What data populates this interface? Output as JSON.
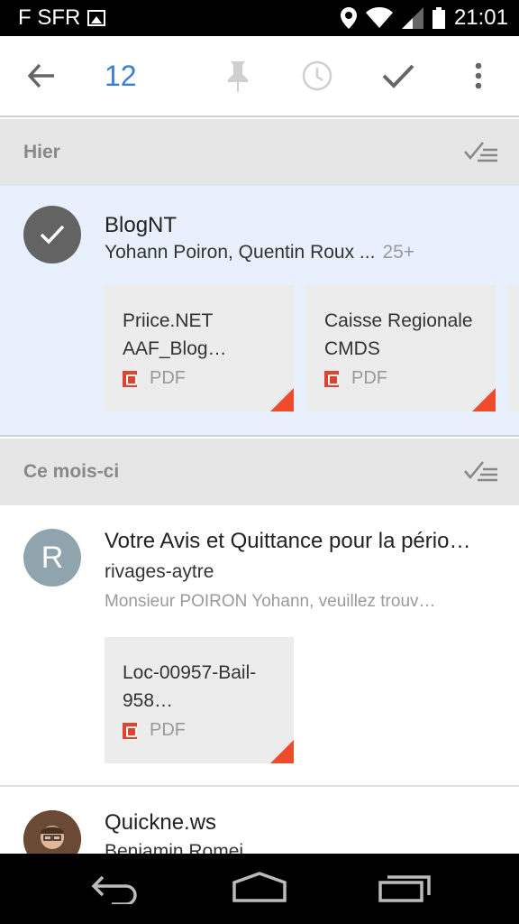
{
  "status": {
    "carrier": "F SFR",
    "time": "21:01"
  },
  "toolbar": {
    "back_icon": "arrow-back-icon",
    "selected_count": "12",
    "pin_icon": "pin-icon",
    "snooze_icon": "clock-icon",
    "done_icon": "check-icon",
    "overflow_icon": "more-vert-icon"
  },
  "sections": [
    {
      "label": "Hier"
    },
    {
      "label": "Ce mois-ci"
    }
  ],
  "threads": [
    {
      "title": "BlogNT",
      "senders": "Yohann Poiron, Quentin Roux ...",
      "count": "25+",
      "selected": true,
      "attachments": [
        {
          "name": "Priice.NET AAF_Blog…",
          "type": "PDF"
        },
        {
          "name": "Caisse Regionale CMDS",
          "type": "PDF"
        }
      ]
    },
    {
      "avatar_letter": "R",
      "title": "Votre Avis et Quittance pour la pério…",
      "senders": "rivages-aytre",
      "snippet": "Monsieur POIRON Yohann, veuillez trouv…",
      "attachments": [
        {
          "name": "Loc-00957-Bail-958…",
          "type": "PDF"
        }
      ]
    },
    {
      "title": "Quickne.ws",
      "senders": "Benjamin Romei"
    }
  ],
  "colors": {
    "accent": "#3b7fd4",
    "selected_bg": "#e8f0fd",
    "pdf_red": "#e0442e"
  }
}
